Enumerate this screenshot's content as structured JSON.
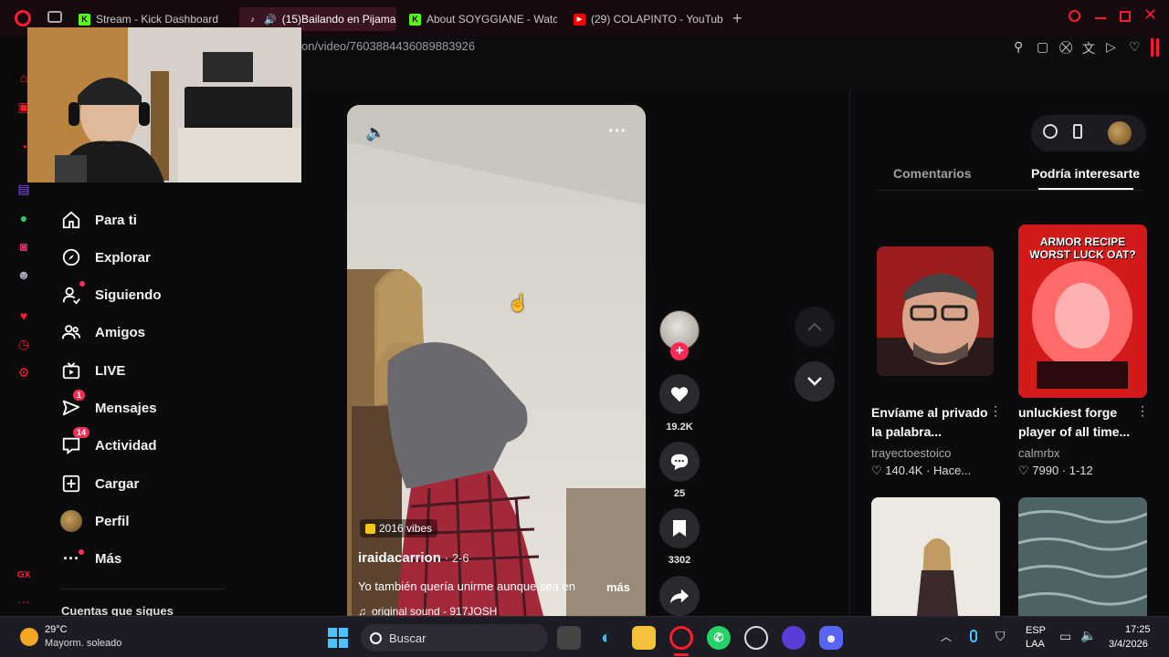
{
  "browser": {
    "tabs": [
      {
        "label": "Stream - Kick Dashboard",
        "icon": "kick-icon"
      },
      {
        "label": "(15)Bailando en Pijama",
        "icon": "tiktok-icon"
      },
      {
        "label": "About SOYGGIANE - Watc",
        "icon": "kick-icon"
      },
      {
        "label": "(29) COLAPINTO - YouTub",
        "icon": "youtube-icon"
      }
    ],
    "url": "on/video/7603884436089883926"
  },
  "nav": {
    "items": [
      {
        "label": "Para ti",
        "icon": "home-icon"
      },
      {
        "label": "Explorar",
        "icon": "compass-icon"
      },
      {
        "label": "Siguiendo",
        "icon": "following-icon"
      },
      {
        "label": "Amigos",
        "icon": "friends-icon"
      },
      {
        "label": "LIVE",
        "icon": "live-icon"
      },
      {
        "label": "Mensajes",
        "icon": "messages-icon",
        "badge": "1"
      },
      {
        "label": "Actividad",
        "icon": "activity-icon",
        "badge": "14"
      },
      {
        "label": "Cargar",
        "icon": "upload-icon"
      },
      {
        "label": "Perfil",
        "icon": "avatar-icon"
      },
      {
        "label": "Más",
        "icon": "more-icon"
      }
    ],
    "following_heading": "Cuentas que sigues"
  },
  "video": {
    "sound_badge": "2016 vibes",
    "author": "iraidacarrion",
    "date": "· 2-6",
    "caption": "Yo también quería unirme aunque sea en",
    "more": "más",
    "sound": "original sound - 917JOSH"
  },
  "actions": {
    "likes": "19.2K",
    "comments": "25",
    "saves": "3302"
  },
  "panel": {
    "tab_comments": "Comentarios",
    "tab_suggest": "Podría interesarte",
    "cards": [
      {
        "title_line1": "Envíame al privado",
        "title_line2": "la palabra...",
        "author": "trayectoestoico",
        "stats": "♡ 140.4K · Hace..."
      },
      {
        "title_line1": "unluckiest forge",
        "title_line2": "player of all time...",
        "author": "calmrbx",
        "stats": "♡ 7990 · 1-12",
        "thumb_text": "ARMOR RECIPE WORST LUCK OAT?"
      }
    ]
  },
  "taskbar": {
    "weather_temp": "29°C",
    "weather_desc": "Mayorm. soleado",
    "search": "Buscar",
    "lang1": "ESP",
    "lang2": "LAA",
    "time": "17:25",
    "date": "3/4/2026"
  },
  "colors": {
    "accent": "#fe2c55",
    "opera": "#ff1b2d"
  }
}
